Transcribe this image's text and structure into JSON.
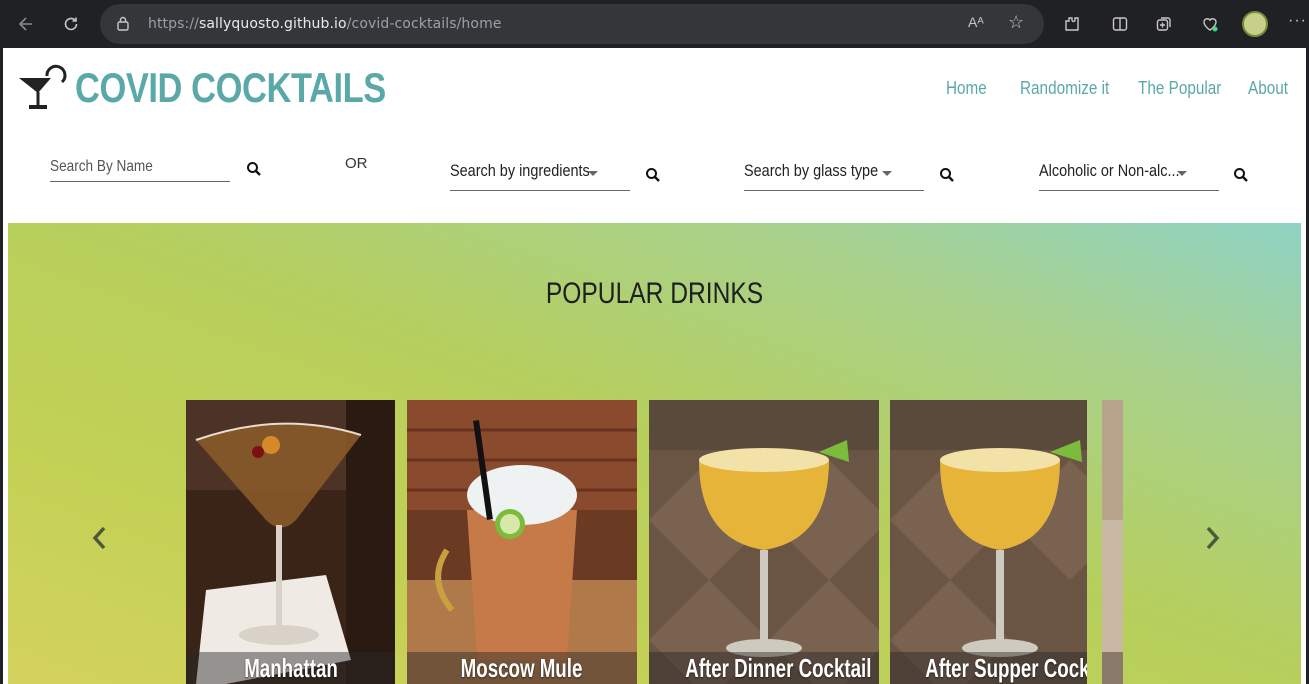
{
  "browser": {
    "url_prefix": "https://",
    "url_host": "sallyquosto.github.io",
    "url_path": "/covid-cocktails/home",
    "reader_mode_label": "Aᴬ"
  },
  "site": {
    "logo_text": "COVID COCKTAILS",
    "brand_color": "#5ba8a8"
  },
  "nav": {
    "items": [
      "Home",
      "Randomize it",
      "The Popular",
      "About"
    ]
  },
  "search": {
    "name_placeholder": "Search By Name",
    "or_label": "OR",
    "ingredients_label": "Search by ingredients",
    "glass_label": "Search by glass type",
    "alcoholic_label": "Alcoholic or Non-alc..."
  },
  "popular": {
    "title": "POPULAR DRINKS",
    "drinks": [
      "Manhattan",
      "Moscow Mule",
      "After Dinner Cocktail",
      "After Supper Cockta"
    ]
  }
}
